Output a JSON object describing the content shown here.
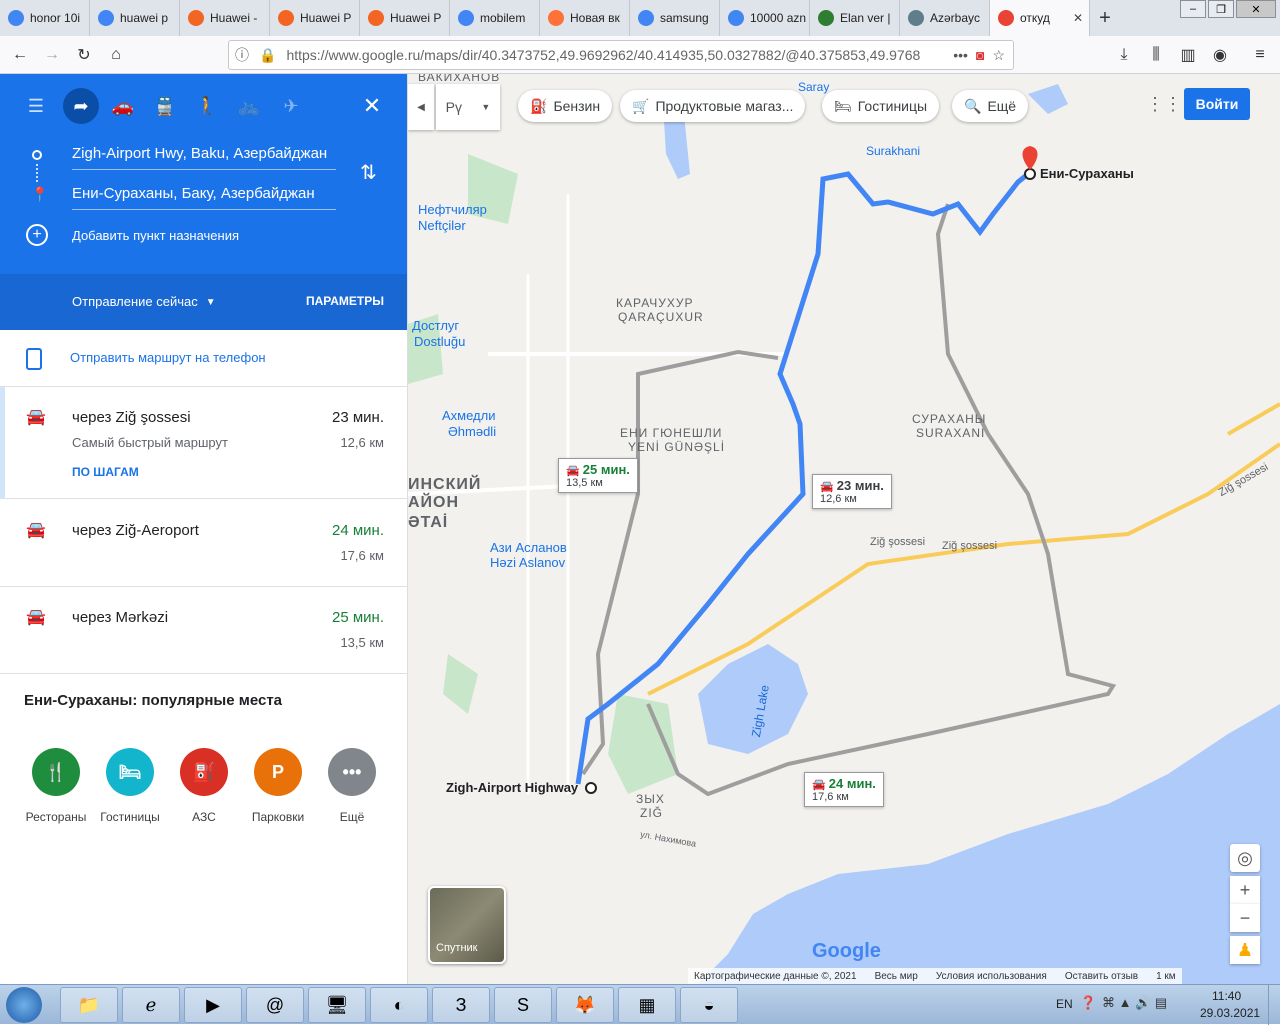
{
  "browser": {
    "tabs": [
      {
        "title": "honor 10i",
        "icon": "google-icon",
        "color": "#4285f4"
      },
      {
        "title": "huawei p",
        "icon": "google-icon",
        "color": "#4285f4"
      },
      {
        "title": "Huawei -",
        "icon": "t-icon",
        "color": "#f26522"
      },
      {
        "title": "Huawei P",
        "icon": "t-icon",
        "color": "#f26522"
      },
      {
        "title": "Huawei P",
        "icon": "t-icon",
        "color": "#f26522"
      },
      {
        "title": "mobilem",
        "icon": "google-icon",
        "color": "#4285f4"
      },
      {
        "title": "Новая вк",
        "icon": "firefox-icon",
        "color": "#ff7139"
      },
      {
        "title": "samsung",
        "icon": "google-icon",
        "color": "#4285f4"
      },
      {
        "title": "10000 azn",
        "icon": "google-icon",
        "color": "#4285f4"
      },
      {
        "title": "Elan ver |",
        "icon": "elan-icon",
        "color": "#2e7d32"
      },
      {
        "title": "Azərbayc",
        "icon": "globe-icon",
        "color": "#607d8b"
      },
      {
        "title": "откуд",
        "icon": "maps-pin-icon",
        "color": "#ea4335"
      }
    ],
    "url": "https://www.google.ru/maps/dir/40.3473752,49.9692962/40.414935,50.0327882/@40.375853,49.9768"
  },
  "panel": {
    "origin": "Zigh-Airport Hwy, Baku, Азербайджан",
    "destination": "Ени-Сураханы, Баку, Азербайджан",
    "add_destination": "Добавить пункт назначения",
    "departure": "Отправление сейчас",
    "options": "ПАРАМЕТРЫ",
    "send_to_phone": "Отправить маршрут на телефон",
    "routes": [
      {
        "via": "через Ziğ şossesi",
        "time": "23 мин.",
        "distance": "12,6 км",
        "subtitle": "Самый быстрый маршрут",
        "steps": "ПО ШАГАМ"
      },
      {
        "via": "через Ziğ-Aeroport",
        "time": "24 мин.",
        "distance": "17,6 км"
      },
      {
        "via": "через Mərkəzi",
        "time": "25 мин.",
        "distance": "13,5 км"
      }
    ],
    "popular_title": "Ени-Сураханы: популярные места",
    "popular": [
      {
        "label": "Рестораны",
        "color": "#1e8e3e",
        "icon": "fork-knife-icon",
        "glyph": "🍴"
      },
      {
        "label": "Гостиницы",
        "color": "#12b5cb",
        "icon": "bed-icon",
        "glyph": "🛏"
      },
      {
        "label": "АЗС",
        "color": "#d93025",
        "icon": "gas-icon",
        "glyph": "⛽"
      },
      {
        "label": "Парковки",
        "color": "#e8710a",
        "icon": "parking-icon",
        "glyph": "P"
      },
      {
        "label": "Ещё",
        "color": "#80868b",
        "icon": "more-icon",
        "glyph": "•••"
      }
    ]
  },
  "map": {
    "chips": {
      "gas": "Бензин",
      "grocery": "Продуктовые магаз...",
      "hotels": "Гостиницы",
      "more": "Ещё",
      "lang": "Рү"
    },
    "signin": "Войти",
    "labels": {
      "surakhani_station": "Surakhani",
      "saray": "Saray",
      "vakhansy": "ВАКИХАНОВ",
      "neftchilar_ru": "Нефтчиляр",
      "neftchilar_az": "Neftçilər",
      "karachukhur_ru": "КАРАЧУХУР",
      "karachukhur_az": "QARAÇUXUR",
      "dostlug_ru": "Достлуг",
      "dostlug_az": "Dostluğu",
      "akhmedli_ru": "Ахмедли",
      "akhmedli_az": "Əhmədli",
      "yeni_gunashli_ru": "ЕНИ ГЮНЕШЛИ",
      "yeni_gunashli_az": "YENİ GÜNƏŞLİ",
      "surakhani_ru": "СУРАХАНЫ",
      "surakhani_az": "SURAXANI",
      "district_ru_1": "ИНСКИЙ",
      "district_ru_2": "АЙОН",
      "district_az": "ƏTAİ",
      "aslanov_ru": "Ази Асланов",
      "aslanov_az": "Həzi Aslanov",
      "zig_ru": "ЗЫХ",
      "zig_az": "ZIĞ",
      "zigh_lake": "Zigh Lake",
      "zig_sossesi_1": "Ziğ şossesi",
      "zig_sossesi_2": "Ziğ şossesi",
      "zig_sossesi_3": "Ziğ şossesi",
      "nakhimova": "ул. Нахимова",
      "origin_label": "Zigh-Airport Highway",
      "dest_label": "Ени-Сураханы",
      "satellite": "Спутник",
      "google": "Google"
    },
    "timeboxes": [
      {
        "time": "25 мин.",
        "dist": "13,5 км"
      },
      {
        "time": "23 мин.",
        "dist": "12,6 км"
      },
      {
        "time": "24 мин.",
        "dist": "17,6 км"
      }
    ],
    "attribution": {
      "data": "Картографические данные ©, 2021",
      "world": "Весь мир",
      "terms": "Условия использования",
      "feedback": "Оставить отзыв",
      "scale": "1 км"
    }
  },
  "taskbar": {
    "lang": "EN",
    "time": "11:40",
    "date": "29.03.2021"
  }
}
